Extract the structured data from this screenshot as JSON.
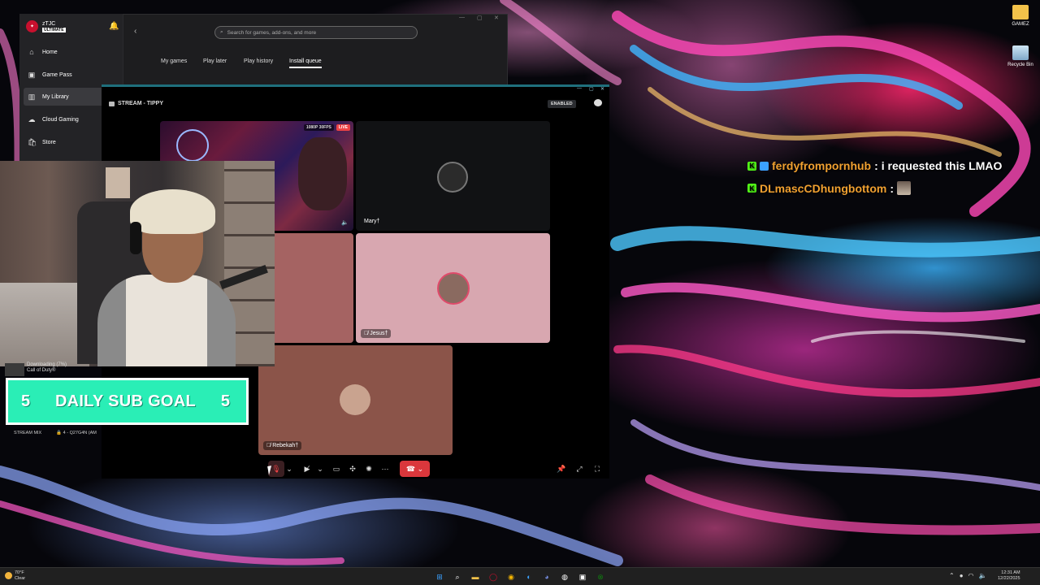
{
  "desktop": {
    "icons": [
      {
        "label": "GAMEZ",
        "icon": "folder-icon"
      },
      {
        "label": "Recycle Bin",
        "icon": "recycle-bin-icon"
      }
    ]
  },
  "xbox_app": {
    "gamertag": "zTJC",
    "badge": "ULTIMATE",
    "notification_count": "2",
    "sidebar": [
      {
        "label": "Home",
        "icon": "home-icon"
      },
      {
        "label": "Game Pass",
        "icon": "game-pass-icon"
      },
      {
        "label": "My Library",
        "icon": "library-icon",
        "active": true
      },
      {
        "label": "Cloud Gaming",
        "icon": "cloud-icon"
      },
      {
        "label": "Store",
        "icon": "store-icon"
      }
    ],
    "search_placeholder": "Search for games, add-ons, and more",
    "tabs": [
      "My games",
      "Play later",
      "Play history",
      "Install queue"
    ],
    "active_tab": "Install queue",
    "downloading_status": "Downloading (7%)",
    "downloading_game": "Call of Duty®"
  },
  "discord_stream": {
    "title": "STREAM - TIPPY",
    "enabled_badge": "ENABLED",
    "stream_resolution": "1080P 30FPS",
    "live_label": "LIVE",
    "participants": [
      {
        "name": "Mary†",
        "muted": false
      },
      {
        "name": "Jesus†",
        "muted": true
      },
      {
        "name": "Rebekah†",
        "muted": true
      }
    ]
  },
  "overlay": {
    "sub_goal": {
      "current": "5",
      "title": "DAILY SUB GOAL",
      "target": "5"
    },
    "stream_mix_label": "STREAM MIX",
    "device_label": "4 - Q27G4N (AM"
  },
  "chat": [
    {
      "user": "ferdyfrompornhub",
      "message": "i requested this LMAO",
      "badges": [
        "kick",
        "verified"
      ]
    },
    {
      "user": "DLmascCDhungbottom",
      "message": "",
      "badges": [
        "kick"
      ],
      "emote": true
    }
  ],
  "taskbar": {
    "temperature": "70°F",
    "condition": "Clear",
    "time": "12:31 AM",
    "date": "12/22/2025"
  },
  "colors": {
    "goal_green": "#2aeeb6",
    "chat_username": "#f0a030",
    "discord_red": "#da373c",
    "kick_green": "#53fc18"
  }
}
